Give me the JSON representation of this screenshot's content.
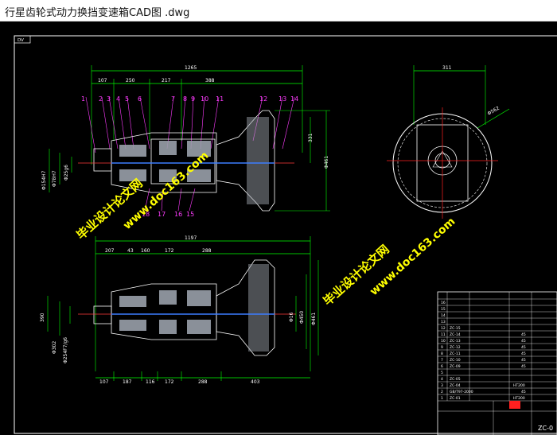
{
  "window": {
    "title": "行星齿轮式动力换挡变速箱CAD图 .dwg"
  },
  "drawing": {
    "layer_tag": "DV",
    "colors": {
      "background": "#000000",
      "dimension": "#00ff00",
      "outline": "#ffffff",
      "leader": "#ff3cff",
      "center": "#ff2020",
      "watermark": "#ffff00",
      "dim_text": "#ffffff"
    },
    "top_view": {
      "overall_dim": "1265",
      "segment_dims": [
        "107",
        "250",
        "217",
        "388"
      ],
      "part_numbers": [
        "1",
        "2",
        "3",
        "4",
        "5",
        "6",
        "7",
        "8",
        "9",
        "10",
        "11",
        "12",
        "13",
        "14"
      ],
      "bottom_part_numbers": [
        "18",
        "17",
        "16",
        "15"
      ],
      "height_dim": "331",
      "diam_right": "Φ461",
      "diam_left": [
        "Φ154H7",
        "Φ78H7",
        "Φ25g6"
      ]
    },
    "side_view": {
      "width_dim": "311",
      "diam": "Φ562"
    },
    "bottom_view": {
      "overall_dim": "1197",
      "segment_dims": [
        "207",
        "43",
        "160",
        "172",
        "288"
      ],
      "bottom_dims": [
        "107",
        "187",
        "116",
        "172",
        "288",
        "403"
      ],
      "height_dim": "390",
      "diam_right": [
        "Φ450",
        "Φ461"
      ],
      "diam_small": "Φ16",
      "diam_left": [
        "Φ302",
        "Φ254F7/g6"
      ]
    },
    "title_block": {
      "drawing_no": "ZC-0",
      "part_rows": [
        "ZC-15",
        "ZC-14",
        "ZC-13",
        "ZC-12",
        "ZC-11",
        "ZC-10",
        "ZC-09",
        "ZC-05",
        "ZC-04",
        "GB/T97-2000",
        "ZC-01"
      ],
      "material_rows": [
        "45",
        "45",
        "45",
        "45",
        "45",
        "45",
        "HT200",
        "45",
        "HT200"
      ],
      "row_numbers": [
        "16",
        "15",
        "14",
        "13",
        "12",
        "11",
        "10",
        "9",
        "8",
        "7",
        "6",
        "5",
        "4",
        "3",
        "2",
        "1"
      ]
    },
    "watermarks": {
      "cn": "毕业设计论文网",
      "url": "www.doc163.com"
    }
  }
}
